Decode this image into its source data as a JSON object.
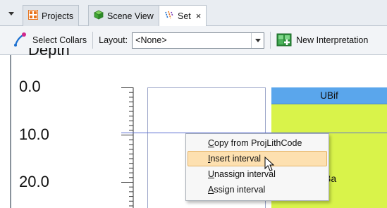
{
  "tabs": [
    {
      "label": "Projects",
      "icon": "projects-grid-icon",
      "color": "#e8731c"
    },
    {
      "label": "Scene View",
      "icon": "scene-cube-icon",
      "color": "#3fa535"
    },
    {
      "label": "Set",
      "icon": "drillhole-set-icon",
      "active": true,
      "close": "×"
    }
  ],
  "toolbar": {
    "select_collars_label": "Select Collars",
    "layout_label": "Layout:",
    "layout_value": "<None>",
    "new_interpretation_label": "New Interpretation"
  },
  "depth_axis": {
    "title": "Depth",
    "labels": [
      "0.0",
      "10.0",
      "20.0"
    ]
  },
  "unit_column": {
    "header": "UBif",
    "partial_label": "Ba",
    "header_color": "#5aa6ec",
    "fill_color": "#d9f34a"
  },
  "context_menu": {
    "items": [
      {
        "label": "Copy from ProjLithCode",
        "accel": "C",
        "rest": "opy from ProjLithCode"
      },
      {
        "label": "Insert interval",
        "accel": "I",
        "rest": "nsert interval",
        "highlighted": true
      },
      {
        "label": "Unassign interval",
        "accel": "U",
        "rest": "nassign interval"
      },
      {
        "label": "Assign interval",
        "accel": "A",
        "rest": "ssign interval"
      }
    ]
  }
}
